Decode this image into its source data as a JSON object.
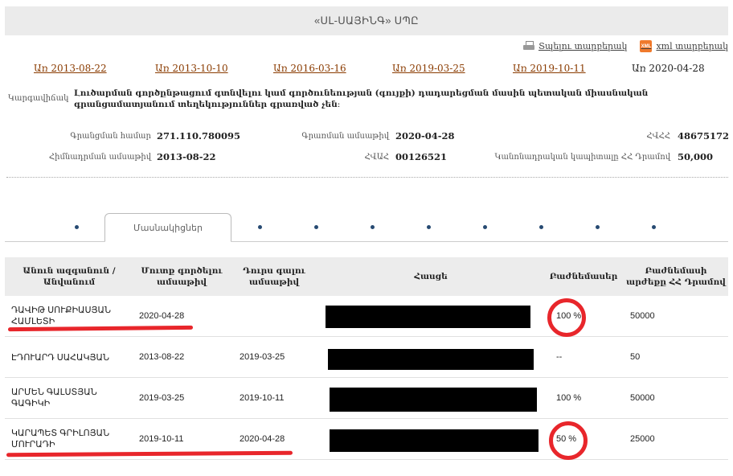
{
  "header": {
    "title": "«ՍԼ-ՍԱՅԻՆԳ» ՍՊԸ"
  },
  "actions": {
    "print_label": "Տպելու տարբերակ",
    "xml_label": "xml տարբերակ",
    "xml_icon_text": "XML"
  },
  "history": {
    "dates": [
      "Առ 2013-08-22",
      "Առ 2013-10-10",
      "Առ 2016-03-16",
      "Առ 2019-03-25",
      "Առ 2019-10-11"
    ],
    "current": "Առ 2020-04-28"
  },
  "status": {
    "label": "Կարգավիճակ",
    "text": "Լուծարման գործընթացում գտնվելու կամ գործունեության (գույքի) դադարեցման մասին պետական միասնական գրանցամատյանում տեղեկություններ գրառված չեն։"
  },
  "info": {
    "reg_number_label": "Գրանցման համար",
    "reg_number": "271.110.780095",
    "reg_date_label": "Գրառման ամսաթիվ",
    "reg_date": "2020-04-28",
    "tin_label": "ՀՎՀՀ",
    "tin": "48675172",
    "founded_label": "Հիմնադրման ամսաթիվ",
    "founded": "2013-08-22",
    "code_label": "ՀՎԱՀ",
    "code": "00126521",
    "capital_label": "Կանոնադրական կապիտալը ՀՀ Դրամով",
    "capital": "50,000"
  },
  "tabs": {
    "active": "Մասնակիցներ"
  },
  "table": {
    "columns": [
      "Անուն ազգանուն / Անվանում",
      "Մուտք գործելու ամսաթիվ",
      "Դուրս գալու ամսաթիվ",
      "Հասցե",
      "Բաժնեմասեր",
      "Բաժնեմասի արժեքը ՀՀ Դրամով"
    ],
    "rows": [
      {
        "name": "ԴԱՎԻԹ ՍՈՒՔԻԱՍՅԱՆ ՀԱՄԼԵՏԻ",
        "entry": "2020-04-28",
        "exit": "",
        "share": "100 %",
        "value": "50000"
      },
      {
        "name": "ԷԴՈՒԱՐԴ ՍԱՀԱԿՅԱՆ",
        "entry": "2013-08-22",
        "exit": "2019-03-25",
        "share": "--",
        "value": "50"
      },
      {
        "name": "ԱՐՄԵՆ ԳԱԼՍՏՅԱՆ ԳԱԳԻԿԻ",
        "entry": "2019-03-25",
        "exit": "2019-10-11",
        "share": "100 %",
        "value": "50000"
      },
      {
        "name": "ԿԱՐԱՊԵՏ ԳՐԻԼՈՅԱՆ ՄՈՒՐԱԴԻ",
        "entry": "2019-10-11",
        "exit": "2020-04-28",
        "share": "50 %",
        "value": "25000"
      }
    ]
  }
}
